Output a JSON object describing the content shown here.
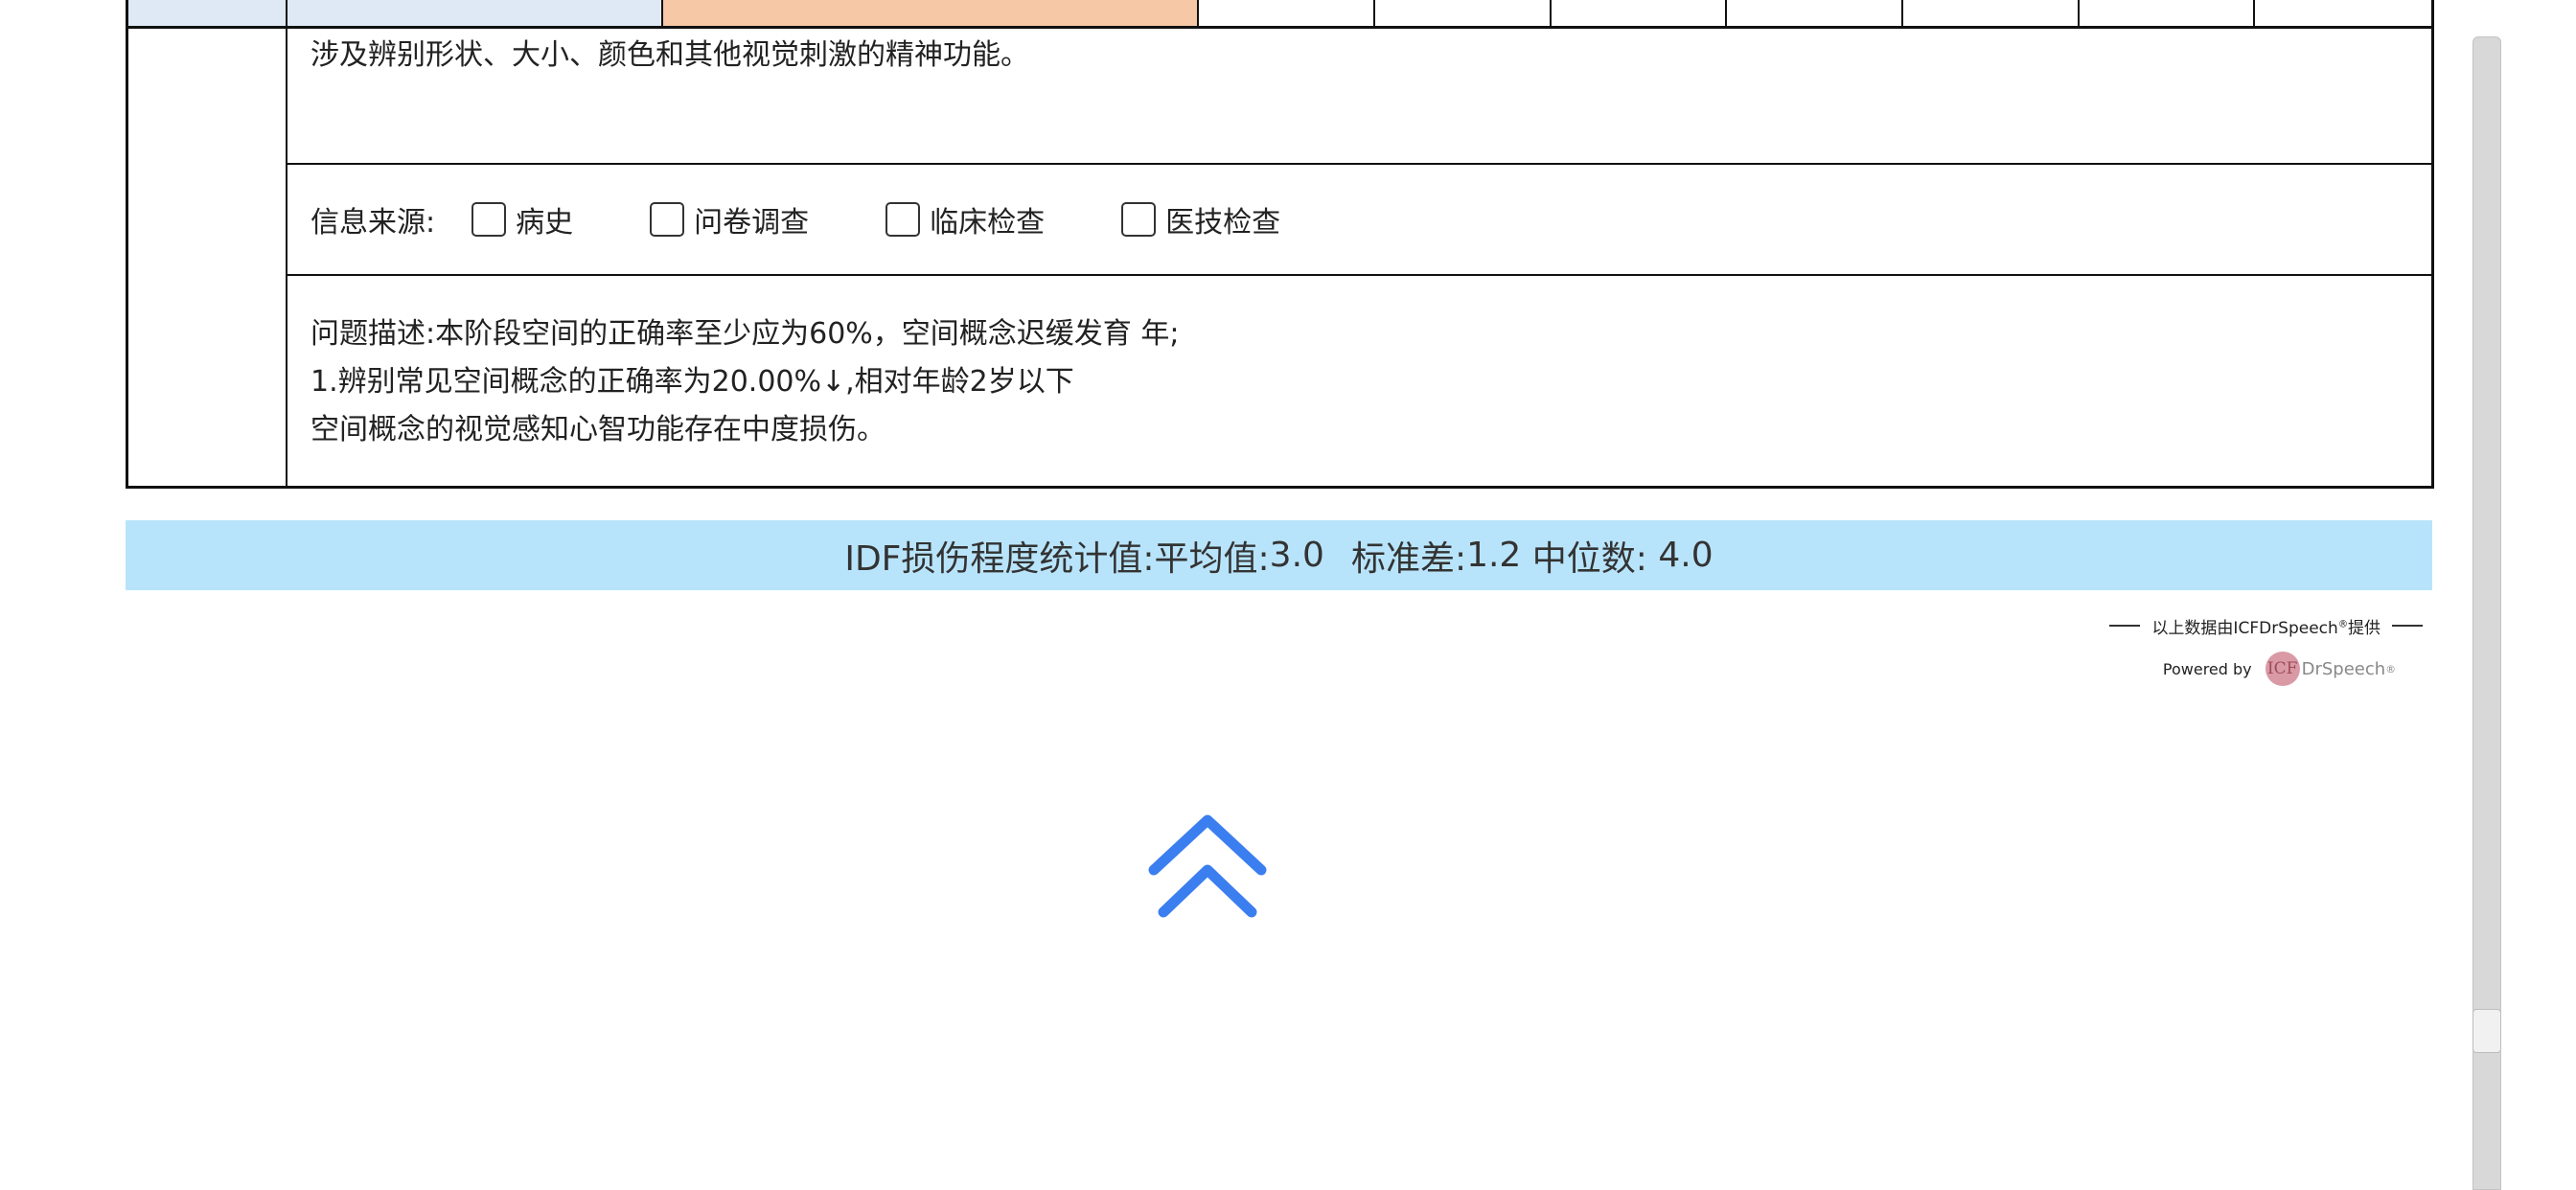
{
  "section": {
    "description": "涉及辨别形状、大小、颜色和其他视觉刺激的精神功能。",
    "source_label": "信息来源:",
    "source_options": [
      {
        "label": "病史",
        "checked": false
      },
      {
        "label": "问卷调查",
        "checked": false
      },
      {
        "label": "临床检查",
        "checked": false
      },
      {
        "label": "医技检查",
        "checked": false
      }
    ],
    "problem_lines": [
      "问题描述:本阶段空间的正确率至少应为60%，空间概念迟缓发育   年;",
      "1.辨别常见空间概念的正确率为20.00%↓,相对年龄2岁以下",
      "空间概念的视觉感知心智功能存在中度损伤。"
    ]
  },
  "stats": {
    "label": "IDF损伤程度统计值:",
    "mean_label": "平均值:",
    "mean_value": "3.0",
    "sd_label": "标准差:",
    "sd_value": "1.2",
    "median_label": "中位数:",
    "median_value": "4.0"
  },
  "credit": {
    "provided_by": "以上数据由ICFDrSpeech",
    "provided_reg": "®",
    "provided_suffix": "提供",
    "powered_by": "Powered by",
    "logo_mark": "ICF",
    "logo_text": "DrSpeech",
    "logo_reg": "®"
  },
  "colors": {
    "header_blue": "#dfe9f6",
    "header_orange": "#f6c8a6",
    "stats_bg": "#b8e4fb",
    "back_top_arrow": "#3b7ef0"
  },
  "icons": {
    "back_to_top": "double-chevron-up-icon"
  }
}
